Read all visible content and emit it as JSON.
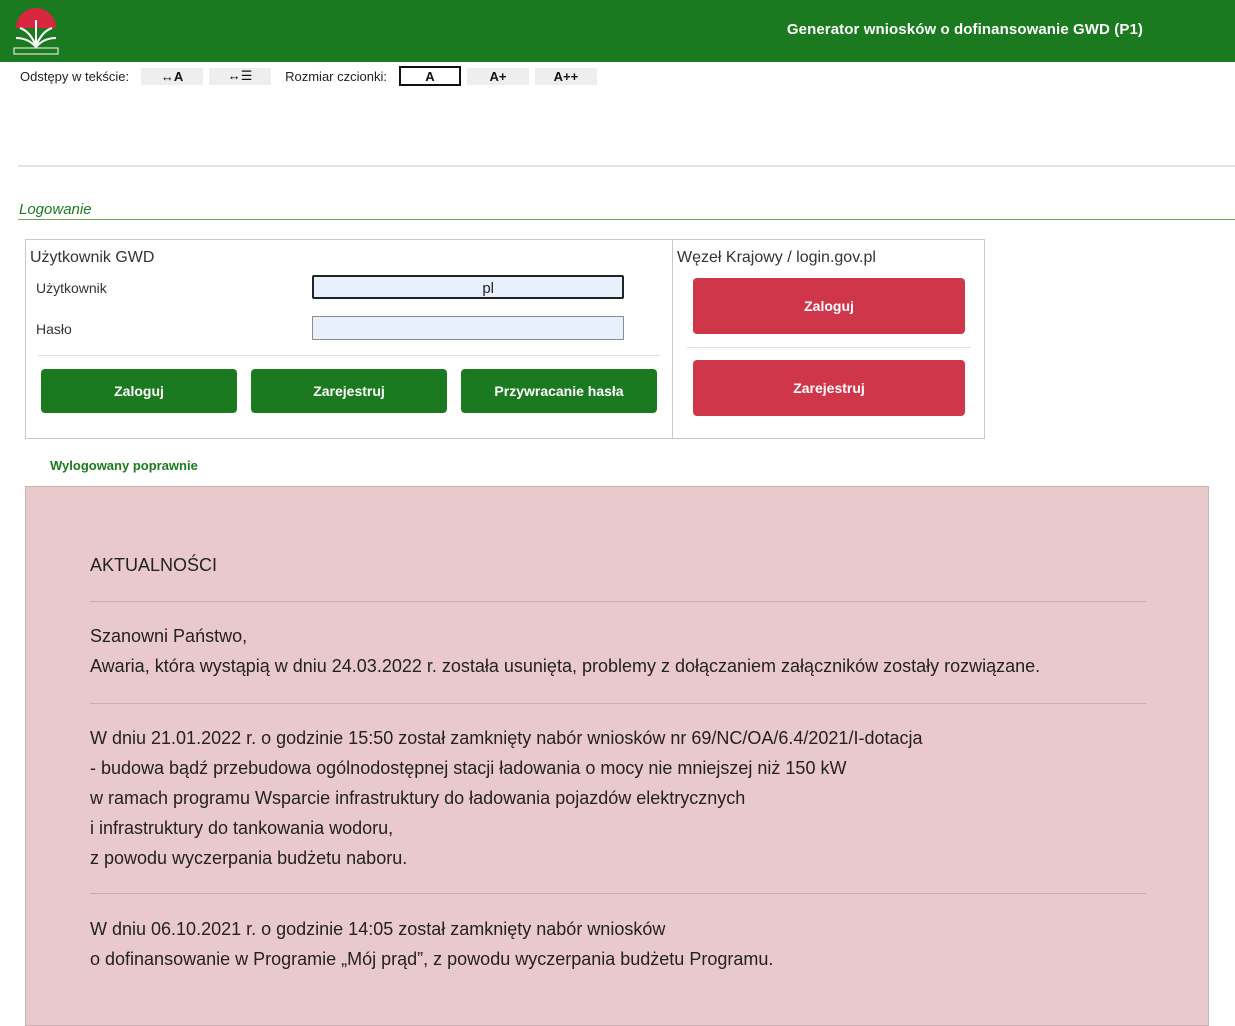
{
  "header": {
    "title": "Generator wniosków o dofinansowanie GWD (P1)",
    "bg_color": "#1b7a1f",
    "logo_icon": "nfosigw-logo-icon"
  },
  "accessibility": {
    "spacing_label": "Odstępy w tekście:",
    "spacing_letters": "↔A",
    "spacing_lines": "↔☰",
    "font_label": "Rozmiar czcionki:",
    "font_normal": "A",
    "font_large": "A+",
    "font_xlarge": "A++"
  },
  "section": {
    "title": "Logowanie"
  },
  "gwd_login": {
    "heading": "Użytkownik GWD",
    "user_label": "Użytkownik",
    "user_value": "pl",
    "password_label": "Hasło",
    "buttons": {
      "login": "Zaloguj",
      "register": "Zarejestruj",
      "reset": "Przywracanie hasła"
    }
  },
  "national_node": {
    "heading": "Węzeł Krajowy / login.gov.pl",
    "login": "Zaloguj",
    "register": "Zarejestruj",
    "button_color": "#d0364a"
  },
  "status": "Wylogowany poprawnie",
  "news": {
    "title": "AKTUALNOŚCI",
    "bg_color": "#eac9cd",
    "item1": {
      "l1": "Szanowni Państwo,",
      "l2": "Awaria, która wystąpią w dniu 24.03.2022 r. została usunięta, problemy z dołączaniem załączników zostały rozwiązane."
    },
    "item2": {
      "l1": "W dniu 21.01.2022 r. o godzinie 15:50 został zamknięty nabór wniosków nr 69/NC/OA/6.4/2021/I-dotacja",
      "l2": "- budowa bądź przebudowa ogólnodostępnej stacji ładowania o mocy nie mniejszej niż 150 kW",
      "l3": "w ramach programu Wsparcie infrastruktury do ładowania pojazdów elektrycznych",
      "l4": "i infrastruktury do tankowania wodoru,",
      "l5": "z powodu wyczerpania budżetu naboru."
    },
    "item3": {
      "l1": "W dniu 06.10.2021 r. o godzinie 14:05 został zamknięty nabór wniosków",
      "l2": "o dofinansowanie w Programie „Mój prąd”, z powodu wyczerpania budżetu Programu."
    }
  }
}
